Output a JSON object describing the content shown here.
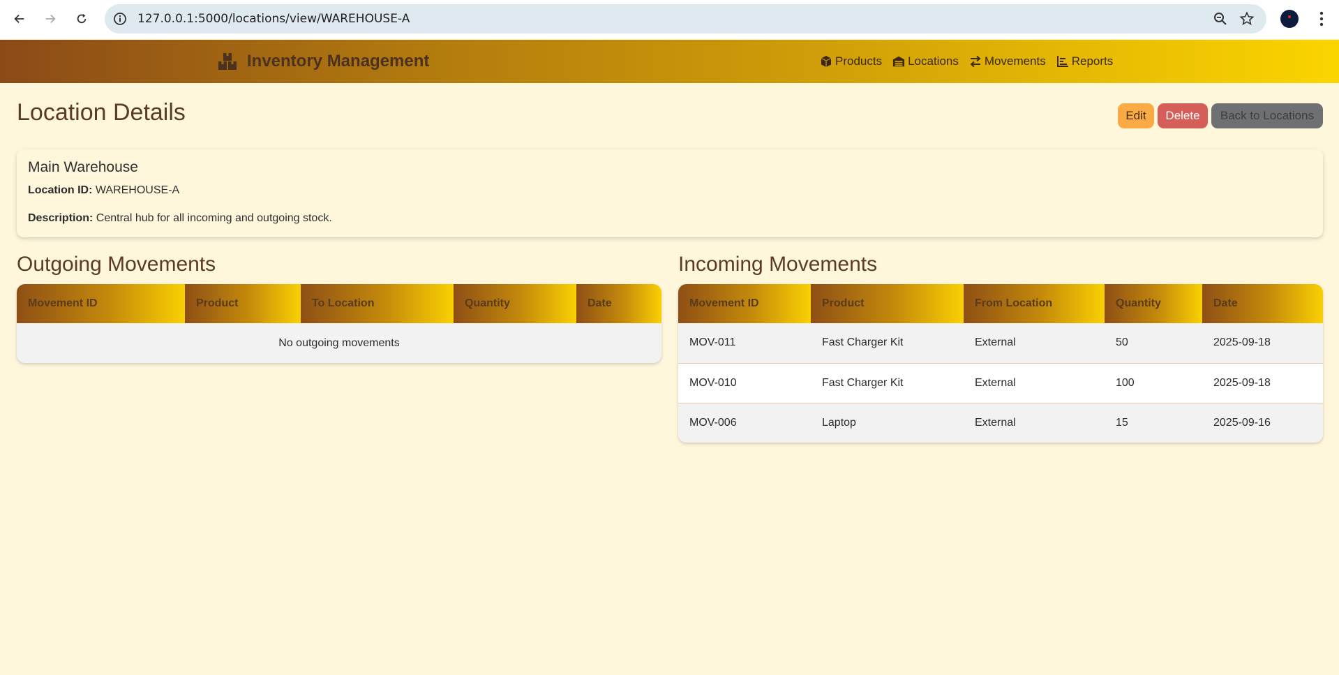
{
  "browser": {
    "url": "127.0.0.1:5000/locations/view/WAREHOUSE-A"
  },
  "navbar": {
    "brand": "Inventory Management",
    "items": [
      {
        "label": "Products",
        "icon": "box-icon"
      },
      {
        "label": "Locations",
        "icon": "warehouse-icon"
      },
      {
        "label": "Movements",
        "icon": "arrows-exchange-icon"
      },
      {
        "label": "Reports",
        "icon": "chart-icon"
      }
    ]
  },
  "page": {
    "title": "Location Details",
    "actions": {
      "edit": "Edit",
      "delete": "Delete",
      "back": "Back to Locations"
    }
  },
  "location": {
    "name": "Main Warehouse",
    "id_label": "Location ID:",
    "id_value": "WAREHOUSE-A",
    "description_label": "Description:",
    "description_value": "Central hub for all incoming and outgoing stock."
  },
  "outgoing": {
    "title": "Outgoing Movements",
    "columns": [
      "Movement ID",
      "Product",
      "To Location",
      "Quantity",
      "Date"
    ],
    "empty_text": "No outgoing movements",
    "rows": []
  },
  "incoming": {
    "title": "Incoming Movements",
    "columns": [
      "Movement ID",
      "Product",
      "From Location",
      "Quantity",
      "Date"
    ],
    "rows": [
      [
        "MOV-011",
        "Fast Charger Kit",
        "External",
        "50",
        "2025-09-18"
      ],
      [
        "MOV-010",
        "Fast Charger Kit",
        "External",
        "100",
        "2025-09-18"
      ],
      [
        "MOV-006",
        "Laptop",
        "External",
        "15",
        "2025-09-16"
      ]
    ]
  }
}
